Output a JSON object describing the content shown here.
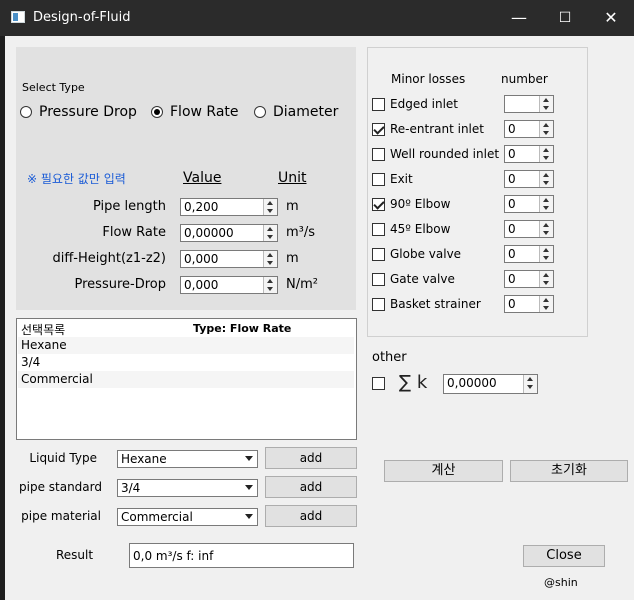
{
  "window": {
    "title": "Design-of-Fluid",
    "minimize": "—",
    "maximize": "☐",
    "close": "✕"
  },
  "select_type": {
    "label": "Select Type",
    "options": [
      {
        "label": "Pressure Drop",
        "selected": false
      },
      {
        "label": "Flow Rate",
        "selected": true
      },
      {
        "label": "Diameter",
        "selected": false
      }
    ]
  },
  "inputs": {
    "hint": "※ 필요한 값만 입력",
    "value_header": "Value",
    "unit_header": "Unit",
    "fields": [
      {
        "label": "Pipe length",
        "value": "0,200",
        "unit": "m"
      },
      {
        "label": "Flow Rate",
        "value": "0,00000",
        "unit": "m³/s"
      },
      {
        "label": "diff-Height(z1-z2)",
        "value": "0,000",
        "unit": "m"
      },
      {
        "label": "Pressure-Drop",
        "value": "0,000",
        "unit": "N/m²"
      }
    ]
  },
  "selection_list": {
    "header_left": "선택목록",
    "header_right": "Type: Flow Rate",
    "items": [
      "Hexane",
      "3/4",
      "Commercial"
    ]
  },
  "selectors": [
    {
      "label": "Liquid Type",
      "value": "Hexane",
      "button": "add"
    },
    {
      "label": "pipe standard",
      "value": "3/4",
      "button": "add"
    },
    {
      "label": "pipe material",
      "value": "Commercial",
      "button": "add"
    }
  ],
  "result": {
    "label": "Result",
    "value": "0,0 m³/s  f: inf"
  },
  "minor_losses": {
    "header": "Minor losses",
    "number_header": "number",
    "items": [
      {
        "label": "Edged inlet",
        "checked": false,
        "value": ""
      },
      {
        "label": "Re-entrant inlet",
        "checked": true,
        "value": "0"
      },
      {
        "label": "Well rounded inlet",
        "checked": false,
        "value": "0"
      },
      {
        "label": "Exit",
        "checked": false,
        "value": "0"
      },
      {
        "label": "90º Elbow",
        "checked": true,
        "value": "0"
      },
      {
        "label": "45º Elbow",
        "checked": false,
        "value": "0"
      },
      {
        "label": "Globe valve",
        "checked": false,
        "value": "0"
      },
      {
        "label": "Gate valve",
        "checked": false,
        "value": "0"
      },
      {
        "label": "Basket strainer",
        "checked": false,
        "value": "0"
      }
    ]
  },
  "other": {
    "label": "other",
    "symbol": "∑ k",
    "checked": false,
    "value": "0,00000"
  },
  "actions": {
    "calculate": "계산",
    "reset": "초기화",
    "close": "Close"
  },
  "credit": "@shin",
  "colors": {
    "titlebar": "#2b2b2b",
    "client_bg": "#f0f0f0",
    "panel_bg": "#e1e1e1",
    "hint_blue": "#1a5bd6"
  }
}
